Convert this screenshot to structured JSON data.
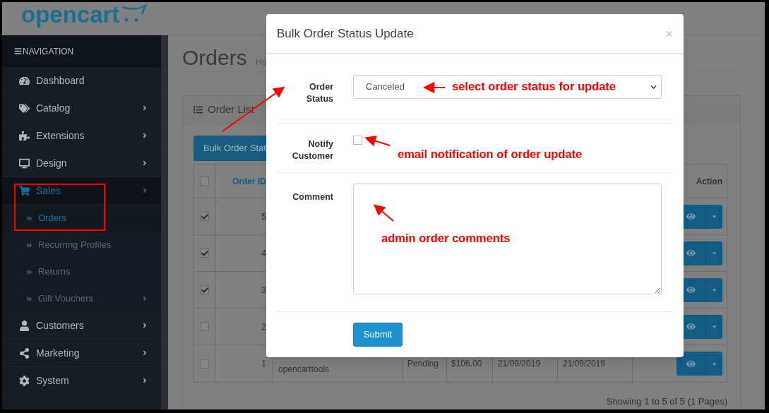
{
  "header": {
    "logo": "opencart"
  },
  "sidebar": {
    "title": "NAVIGATION",
    "items": [
      {
        "label": "Dashboard",
        "selected": false,
        "arrow": false
      },
      {
        "label": "Catalog",
        "selected": false,
        "arrow": true
      },
      {
        "label": "Extensions",
        "selected": false,
        "arrow": true
      },
      {
        "label": "Design",
        "selected": false,
        "arrow": true
      },
      {
        "label": "Sales",
        "selected": true,
        "arrow": true,
        "children": [
          {
            "label": "Orders",
            "selected": true,
            "arrow": false
          },
          {
            "label": "Recurring Profiles",
            "selected": false,
            "arrow": false
          },
          {
            "label": "Returns",
            "selected": false,
            "arrow": false
          },
          {
            "label": "Gift Vouchers",
            "selected": false,
            "arrow": true
          }
        ]
      },
      {
        "label": "Customers",
        "selected": false,
        "arrow": true
      },
      {
        "label": "Marketing",
        "selected": false,
        "arrow": true
      },
      {
        "label": "System",
        "selected": false,
        "arrow": true
      }
    ]
  },
  "page": {
    "title": "Orders",
    "breadcrumb": "Ho"
  },
  "panel": {
    "title": "Order List",
    "bulk_button": "Bulk Order Stat",
    "header_checkbox": {
      "checked": false
    },
    "columns": {
      "order_id": "Order ID",
      "action": "Action"
    },
    "rows": [
      {
        "checked": true,
        "order_id": "5"
      },
      {
        "checked": true,
        "order_id": "4"
      },
      {
        "checked": true,
        "order_id": "3"
      },
      {
        "checked": false,
        "order_id": "2"
      },
      {
        "checked": false,
        "order_id": "1",
        "customer": "opencarttools",
        "status": "Pending",
        "total": "$106.00",
        "date_added": "21/09/2019",
        "date_modified": "21/09/2019"
      }
    ],
    "pagination": "Showing 1 to 5 of 5 (1 Pages)"
  },
  "modal": {
    "title": "Bulk Order Status Update",
    "close": "×",
    "fields": [
      {
        "kind": "select",
        "label": "Order Status",
        "value": "Canceled"
      },
      {
        "kind": "checkbox",
        "label": "Notify Customer",
        "checked": false
      },
      {
        "kind": "textarea",
        "label": "Comment"
      }
    ],
    "submit": "Submit"
  },
  "annotations": [
    "select order status for update",
    "email notification of order update",
    "admin order comments"
  ]
}
